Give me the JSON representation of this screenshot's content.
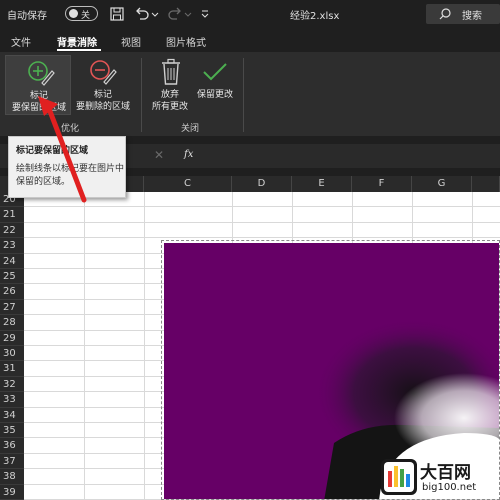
{
  "titlebar": {
    "autosave_label": "自动保存",
    "autosave_state": "关",
    "filename": "经验2.xlsx",
    "search_label": "搜索"
  },
  "tabs": [
    {
      "label": "文件"
    },
    {
      "label": "背景消除",
      "active": true
    },
    {
      "label": "视图"
    },
    {
      "label": "图片格式"
    }
  ],
  "ribbon": {
    "mark_keep_line1": "标记",
    "mark_keep_line2": "要保留的区域",
    "mark_remove_line1": "标记",
    "mark_remove_line2": "要删除的区域",
    "discard_line1": "放弃",
    "discard_line2": "所有更改",
    "keep_changes": "保留更改",
    "group_optimize": "优化",
    "group_close": "关闭"
  },
  "tooltip": {
    "title": "标记要保留的区域",
    "body": "绘制线条以标记要在图片中保留的区域。"
  },
  "formula_bar": {
    "cancel_symbol": "✕",
    "fx_symbol": "fx"
  },
  "sheet": {
    "columns": [
      "A",
      "B",
      "C",
      "D",
      "E",
      "F",
      "G"
    ],
    "rows": [
      "20",
      "21",
      "22",
      "23",
      "24",
      "25",
      "26",
      "27",
      "28",
      "29",
      "30",
      "31",
      "32",
      "33",
      "34",
      "35",
      "36",
      "37",
      "38",
      "39"
    ]
  },
  "watermark": {
    "name": "大百网",
    "url": "big100.net"
  },
  "colors": {
    "accent_green": "#4caf50",
    "accent_red": "#e05555",
    "arrow_red": "#e02020",
    "image_purple": "#660066"
  }
}
